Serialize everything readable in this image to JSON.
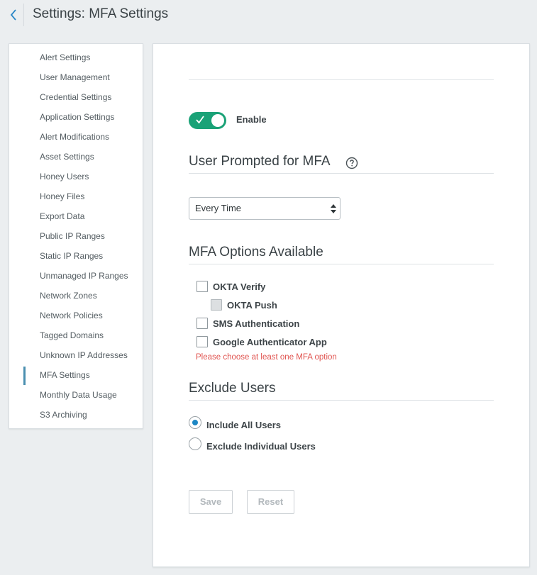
{
  "header": {
    "title": "Settings: MFA Settings",
    "back_icon": "chevron-left-icon"
  },
  "sidebar": {
    "items": [
      {
        "label": "Alert Settings"
      },
      {
        "label": "User Management"
      },
      {
        "label": "Credential Settings"
      },
      {
        "label": "Application Settings"
      },
      {
        "label": "Alert Modifications"
      },
      {
        "label": "Asset Settings"
      },
      {
        "label": "Honey Users"
      },
      {
        "label": "Honey Files"
      },
      {
        "label": "Export Data"
      },
      {
        "label": "Public IP Ranges"
      },
      {
        "label": "Static IP Ranges"
      },
      {
        "label": "Unmanaged IP Ranges"
      },
      {
        "label": "Network Zones"
      },
      {
        "label": "Network Policies"
      },
      {
        "label": "Tagged Domains"
      },
      {
        "label": "Unknown IP Addresses"
      },
      {
        "label": "MFA Settings",
        "active": true
      },
      {
        "label": "Monthly Data Usage"
      },
      {
        "label": "S3 Archiving"
      }
    ]
  },
  "main": {
    "enable_toggle": {
      "label": "Enable",
      "on": true,
      "color": "#1aa277"
    },
    "prompt_section": {
      "title": "User Prompted for MFA",
      "help_icon": "question-circle-icon",
      "select_value": "Every Time"
    },
    "options_section": {
      "title": "MFA Options Available",
      "options": [
        {
          "label": "OKTA Verify",
          "checked": false
        },
        {
          "label": "OKTA Push",
          "checked": false,
          "disabled": true
        },
        {
          "label": "SMS Authentication",
          "checked": false
        },
        {
          "label": "Google Authenticator App",
          "checked": false
        }
      ],
      "error": "Please choose at least one MFA option",
      "error_color": "#e0534f"
    },
    "exclude_section": {
      "title": "Exclude Users",
      "choices": [
        {
          "label": "Include All Users",
          "selected": true
        },
        {
          "label": "Exclude Individual Users",
          "selected": false
        }
      ]
    },
    "buttons": {
      "save_label": "Save",
      "reset_label": "Reset"
    }
  },
  "colors": {
    "accent": "#1d87c4",
    "active_indicator": "#4a8fb0",
    "background": "#ebeef0"
  }
}
